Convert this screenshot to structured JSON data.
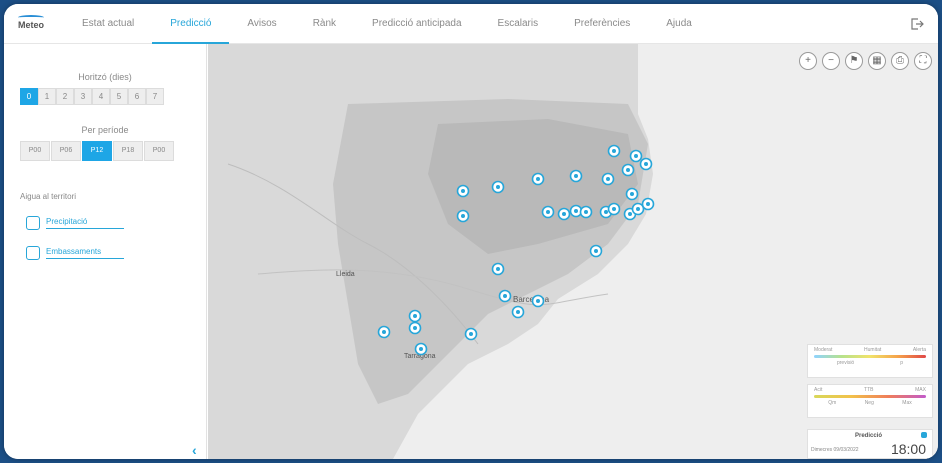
{
  "app": {
    "logo_text": "Meteo"
  },
  "nav": {
    "items": [
      {
        "label": "Estat actual"
      },
      {
        "label": "Predicció"
      },
      {
        "label": "Avisos"
      },
      {
        "label": "Rànk"
      },
      {
        "label": "Predicció anticipada"
      },
      {
        "label": "Escalaris"
      },
      {
        "label": "Preferències"
      },
      {
        "label": "Ajuda"
      }
    ],
    "active_index": 1
  },
  "sidebar": {
    "days_title": "Horitzó (dies)",
    "days": [
      "0",
      "1",
      "2",
      "3",
      "4",
      "5",
      "6",
      "7"
    ],
    "active_day": "0",
    "period_title": "Per període",
    "periods": [
      "P00",
      "P06",
      "P12",
      "P18",
      "P00"
    ],
    "active_period": 2,
    "territory_title": "Aigua al territori",
    "links": [
      {
        "label": "Precipitació",
        "icon": "person-icon"
      },
      {
        "label": "Embassaments",
        "icon": "chart-icon"
      }
    ]
  },
  "map": {
    "tools": [
      "zoom-in-icon",
      "zoom-out-icon",
      "flag-icon",
      "layers-icon",
      "print-icon",
      "fullscreen-icon"
    ],
    "place_labels": [
      "Lleida",
      "Tarragona",
      "Barcelona"
    ],
    "markers_count": 30
  },
  "legend_1": {
    "labels": [
      "Moderat",
      "Humitat",
      "Alerta"
    ],
    "values": [
      "previsió",
      "p"
    ]
  },
  "legend_2": {
    "labels": [
      "Acit",
      "TTB",
      "MAX"
    ],
    "values": [
      "Qm",
      "Neg",
      "Max"
    ]
  },
  "prediction_box": {
    "title": "Predicció",
    "date": "Dimecres 09/03/2022",
    "time": "18:00"
  },
  "colors": {
    "accent": "#27a6d9",
    "active_fill": "#1ea6e6"
  }
}
